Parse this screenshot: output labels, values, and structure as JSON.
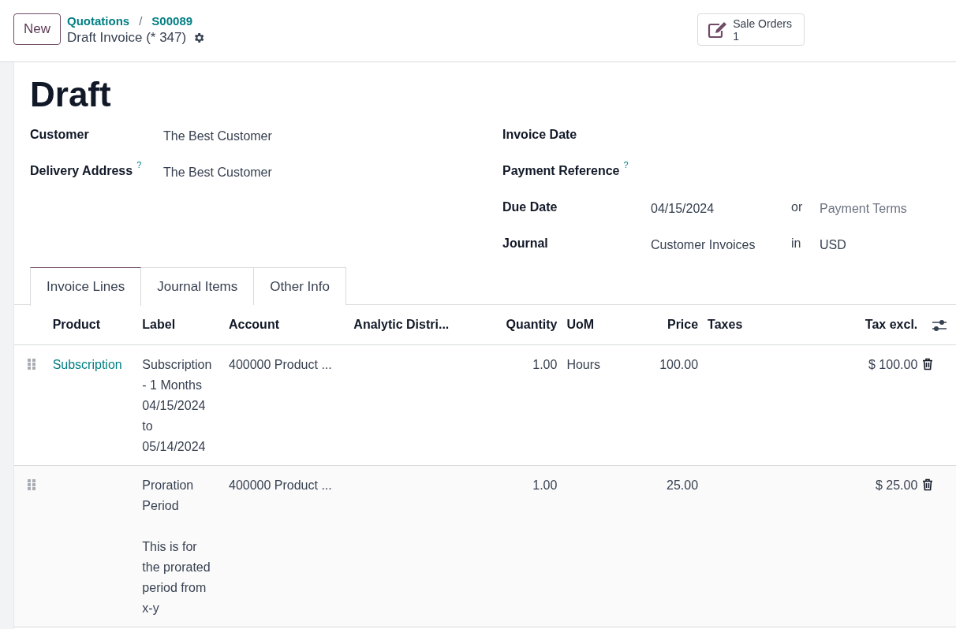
{
  "header": {
    "new_button": "New",
    "breadcrumbs": [
      "Quotations",
      "S00089"
    ],
    "breadcrumb_separator": "/",
    "record_title": "Draft Invoice (* 347)",
    "smart_button": {
      "label": "Sale Orders",
      "count": "1"
    }
  },
  "status_title": "Draft",
  "left_fields": [
    {
      "label": "Customer",
      "value": "The Best Customer"
    },
    {
      "label": "Delivery Address",
      "help": "?",
      "value": "The Best Customer"
    }
  ],
  "right_fields": [
    {
      "label": "Invoice Date"
    },
    {
      "label": "Payment Reference",
      "help": "?"
    },
    {
      "label": "Due Date",
      "value": "04/15/2024",
      "joiner": "or",
      "extra": "Payment Terms",
      "extra_placeholder": true
    },
    {
      "label": "Journal",
      "value": "Customer Invoices",
      "joiner": "in",
      "extra": "USD",
      "extra_placeholder": false
    }
  ],
  "tabs": [
    {
      "label": "Invoice Lines",
      "selected": true
    },
    {
      "label": "Journal Items",
      "selected": false
    },
    {
      "label": "Other Info",
      "selected": false
    }
  ],
  "table": {
    "columns": [
      "Product",
      "Label",
      "Account",
      "Analytic Distri...",
      "Quantity",
      "UoM",
      "Price",
      "Taxes",
      "Tax excl."
    ],
    "rows": [
      {
        "cells": [
          "Subscription",
          "Subscription - 1 Months 04/15/2024 to 05/14/2024",
          "400000 Product ...",
          "",
          "1.00",
          "Hours",
          "100.00",
          "",
          "$ 100.00"
        ]
      },
      {
        "cells": [
          "",
          "Proration Period\n\nThis is for the prorated period from x-y",
          "400000 Product ...",
          "",
          "1.00",
          "",
          "25.00",
          "",
          "$ 25.00"
        ]
      }
    ]
  }
}
